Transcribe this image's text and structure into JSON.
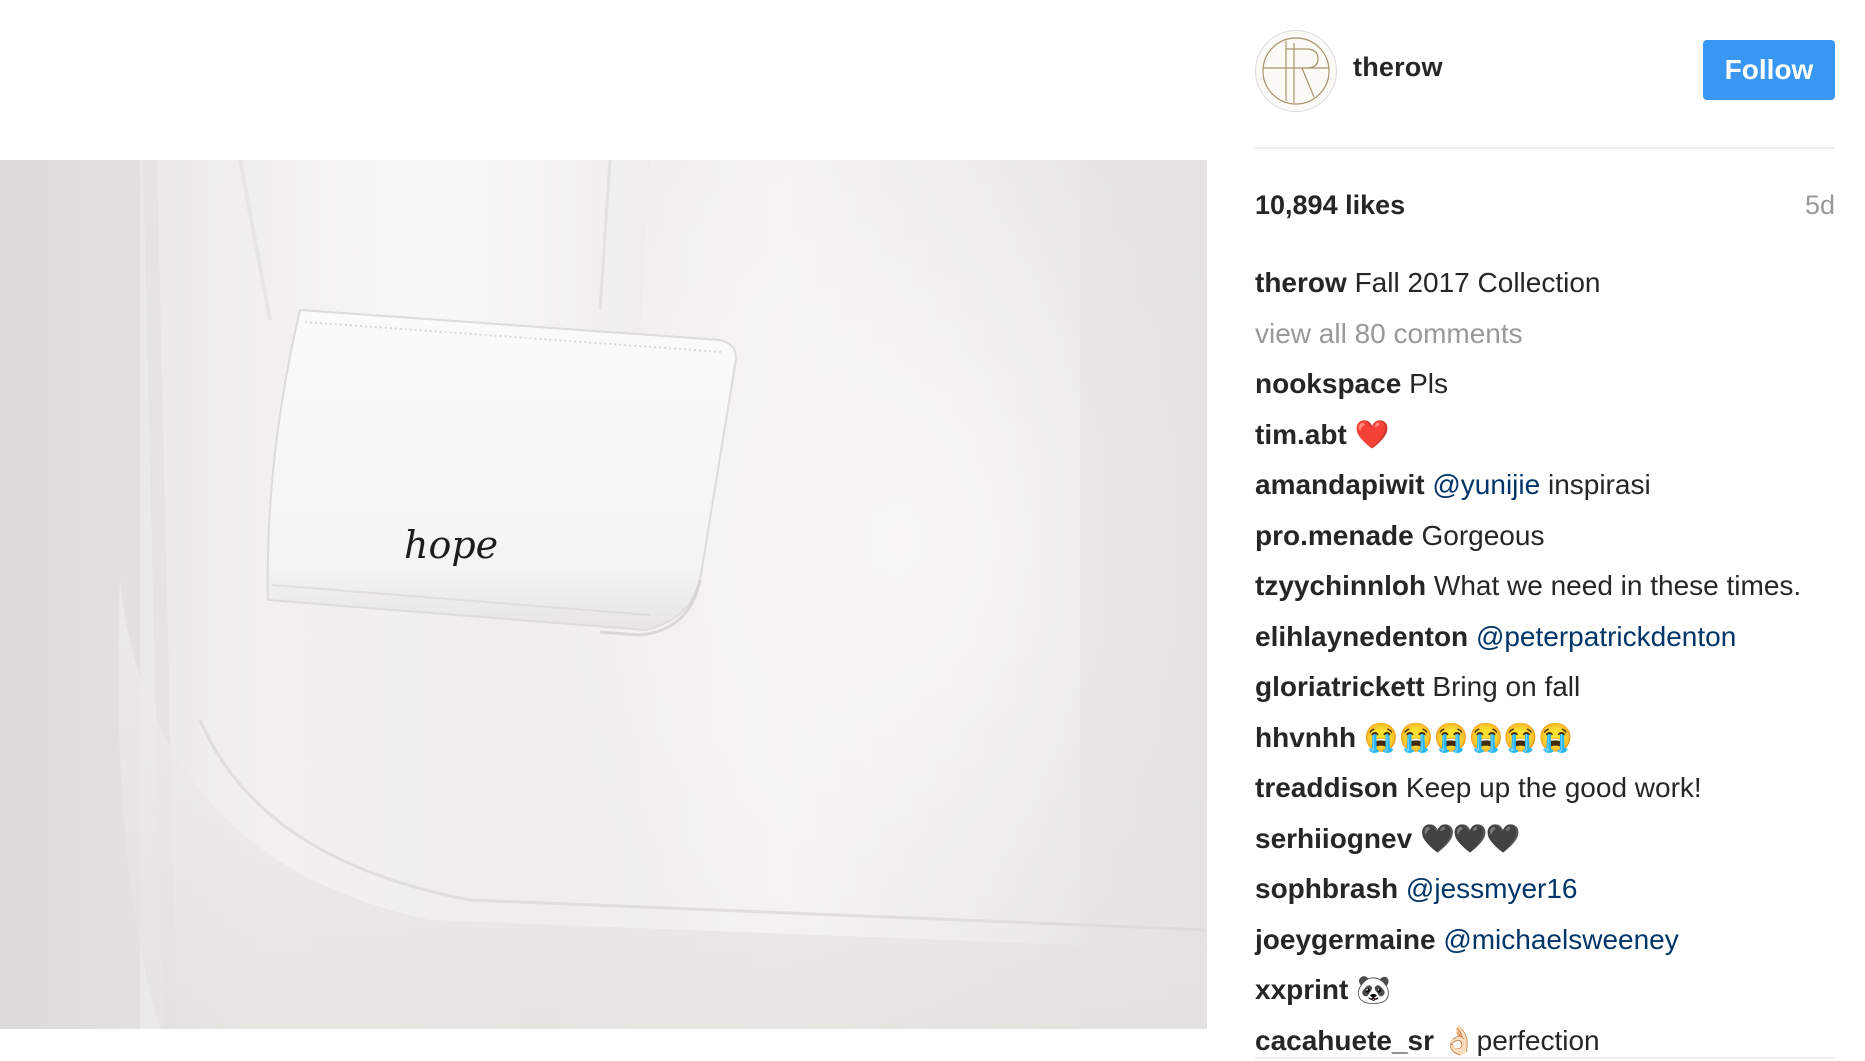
{
  "post": {
    "username": "therow",
    "follow_label": "Follow",
    "likes": "10,894 likes",
    "age": "5d",
    "embroidery_text": "hope"
  },
  "colors": {
    "follow_bg": "#3897f0",
    "mention": "#003569",
    "muted": "#999999",
    "text": "#262626"
  },
  "icons": {
    "avatar": "therow-monogram-logo"
  },
  "caption": {
    "user": "therow",
    "text": "Fall 2017 Collection"
  },
  "view_all": "view all 80 comments",
  "comments": [
    {
      "user": "nookspace",
      "text": "Pls"
    },
    {
      "user": "tim.abt",
      "text": "❤️"
    },
    {
      "user": "amandapiwit",
      "mention": "@yunijie",
      "text": "inspirasi"
    },
    {
      "user": "pro.menade",
      "text": "Gorgeous"
    },
    {
      "user": "tzyychinnloh",
      "text": "What we need in these times."
    },
    {
      "user": "elihlaynedenton",
      "mention": "@peterpatrickdenton",
      "text": ""
    },
    {
      "user": "gloriatrickett",
      "text": "Bring on fall"
    },
    {
      "user": "hhvnhh",
      "text": "😭😭😭😭😭😭"
    },
    {
      "user": "treaddison",
      "text": "Keep up the good work!"
    },
    {
      "user": "serhiiognev",
      "text": "🖤🖤🖤"
    },
    {
      "user": "sophbrash",
      "mention": "@jessmyer16",
      "text": ""
    },
    {
      "user": "joeygermaine",
      "mention": "@michaelsweeney",
      "text": ""
    },
    {
      "user": "xxprint",
      "text": "🐼"
    },
    {
      "user": "cacahuete_sr",
      "text": "👌🏻perfection"
    }
  ]
}
